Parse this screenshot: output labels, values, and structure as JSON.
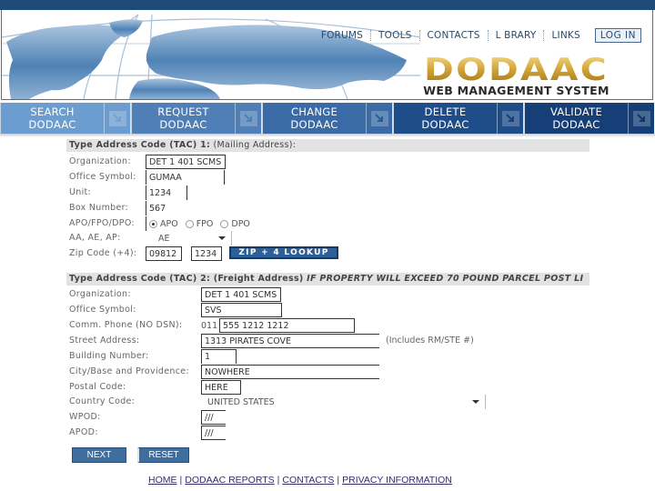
{
  "header": {
    "top_links": [
      "FORUMS",
      "TOOLS",
      "CONTACTS",
      "L BRARY",
      "LINKS"
    ],
    "login_label": "LOG IN",
    "logo_title": "DODAAC",
    "logo_subtitle": "WEB MANAGEMENT SYSTEM"
  },
  "nav": {
    "items": [
      {
        "line1": "SEARCH",
        "line2": "DODAAC",
        "color": "#6c9dd0"
      },
      {
        "line1": "REQUEST",
        "line2": "DODAAC",
        "color": "#4f7fb6"
      },
      {
        "line1": "CHANGE",
        "line2": "DODAAC",
        "color": "#3a6ba6"
      },
      {
        "line1": "DELETE",
        "line2": "DODAAC",
        "color": "#1e4d8a"
      },
      {
        "line1": "VALIDATE",
        "line2": "DODAAC",
        "color": "#163f78"
      }
    ],
    "arrow_icon": "arrow-down-right-icon"
  },
  "tac1": {
    "title_bold": "Type Address Code (TAC) 1:",
    "title_normal": " (Mailing Address):",
    "organization": {
      "label": "Organization:",
      "value": "DET 1 401 SCMS"
    },
    "office_symbol": {
      "label": "Office Symbol:",
      "value": "GUMAA"
    },
    "unit": {
      "label": "Unit:",
      "value": "1234"
    },
    "box_number": {
      "label": "Box Number:",
      "value": "567"
    },
    "apo": {
      "label": "APO/FPO/DPO:",
      "options": [
        "APO",
        "FPO",
        "DPO"
      ],
      "selected": "APO"
    },
    "state": {
      "label": "AA, AE, AP:",
      "value": "AE"
    },
    "zip": {
      "label": "Zip Code (+4):",
      "value": "09812",
      "plus4": "1234"
    },
    "lookup_button": "ZIP + 4 LOOKUP"
  },
  "tac2": {
    "title_bold": "Type Address Code (TAC) 2: (Freight Address)",
    "title_warning": " IF PROPERTY WILL EXCEED 70 POUND PARCEL POST LI",
    "organization": {
      "label": "Organization:",
      "value": "DET 1 401 SCMS"
    },
    "office_symbol": {
      "label": "Office Symbol:",
      "value": "SVS"
    },
    "phone": {
      "label": "Comm. Phone (NO DSN):",
      "prefix": "011",
      "value": "555 1212 1212"
    },
    "street": {
      "label": "Street Address:",
      "value": "1313 PIRATES COVE",
      "hint": "(Includes RM/STE #)"
    },
    "building": {
      "label": "Building Number:",
      "value": "1"
    },
    "city": {
      "label": "City/Base and Providence:",
      "value": "NOWHERE"
    },
    "postal": {
      "label": "Postal Code:",
      "value": "HERE"
    },
    "country": {
      "label": "Country Code:",
      "value": "UNITED STATES"
    },
    "wpod": {
      "label": "WPOD:",
      "value": "///"
    },
    "apod": {
      "label": "APOD:",
      "value": "///"
    }
  },
  "buttons": {
    "next": "NEXT",
    "reset": "RESET"
  },
  "footer": {
    "links": [
      "HOME",
      "DODAAC REPORTS",
      "CONTACTS",
      "PRIVACY INFORMATION"
    ],
    "separator": "|"
  }
}
